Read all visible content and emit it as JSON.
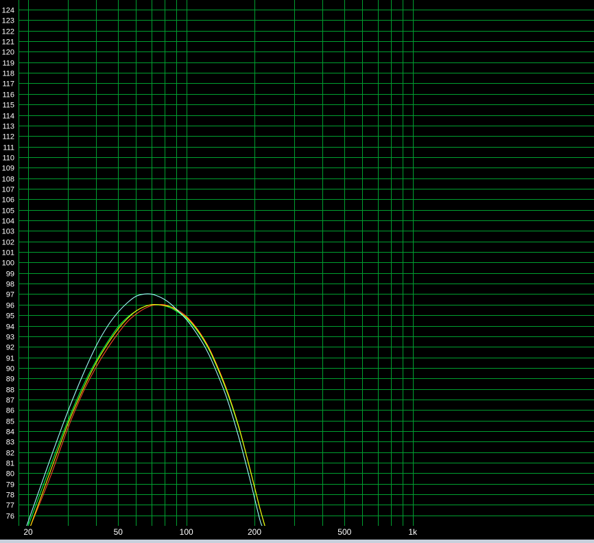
{
  "chart_data": {
    "type": "line",
    "title": "",
    "xlabel": "",
    "ylabel": "",
    "x_scale": "log",
    "xlim": [
      20,
      1000
    ],
    "ylim": [
      75,
      124.6
    ],
    "grid": true,
    "x_tick_labels": [
      {
        "value": 20,
        "label": "20"
      },
      {
        "value": 50,
        "label": "50"
      },
      {
        "value": 100,
        "label": "100"
      },
      {
        "value": 200,
        "label": "200"
      },
      {
        "value": 500,
        "label": "500"
      },
      {
        "value": 1000,
        "label": "1k"
      }
    ],
    "x_gridlines": [
      20,
      30,
      40,
      50,
      60,
      70,
      80,
      90,
      100,
      200,
      300,
      400,
      500,
      600,
      700,
      800,
      900,
      1000
    ],
    "y_tick_labels": [
      76,
      77,
      78,
      79,
      80,
      81,
      82,
      83,
      84,
      85,
      86,
      87,
      88,
      89,
      90,
      91,
      92,
      93,
      94,
      95,
      96,
      97,
      98,
      99,
      100,
      101,
      102,
      103,
      104,
      105,
      106,
      107,
      108,
      109,
      110,
      111,
      112,
      113,
      114,
      115,
      116,
      117,
      118,
      119,
      120,
      121,
      122,
      123,
      124
    ],
    "series": [
      {
        "color": "#ff4a2a",
        "x": [
          20.5,
          25,
          30,
          35,
          40,
          45,
          50,
          55,
          60,
          65,
          70,
          75,
          80,
          85,
          90,
          100,
          110,
          120,
          130,
          150,
          170,
          190,
          210,
          222
        ],
        "y": [
          75,
          79.6,
          84.3,
          87.7,
          90.1,
          91.9,
          93.3,
          94.4,
          95.1,
          95.6,
          95.9,
          96.0,
          96.0,
          95.8,
          95.6,
          94.9,
          93.9,
          92.7,
          91.3,
          88.1,
          84.5,
          80.6,
          76.9,
          75
        ]
      },
      {
        "color": "#00ff44",
        "x": [
          20,
          25,
          30,
          35,
          40,
          45,
          50,
          55,
          60,
          65,
          70,
          75,
          80,
          85,
          90,
          100,
          110,
          120,
          130,
          150,
          170,
          190,
          210,
          222
        ],
        "y": [
          75,
          80.6,
          85.0,
          88.3,
          90.7,
          92.5,
          93.9,
          94.8,
          95.4,
          95.8,
          96.0,
          96.0,
          95.9,
          95.7,
          95.4,
          94.7,
          93.7,
          92.5,
          91.1,
          87.9,
          84.4,
          80.6,
          76.9,
          75
        ]
      },
      {
        "color": "#ffee00",
        "x": [
          20.5,
          25,
          30,
          35,
          40,
          45,
          50,
          55,
          60,
          65,
          70,
          75,
          80,
          85,
          90,
          100,
          110,
          120,
          130,
          150,
          170,
          190,
          210,
          222.5
        ],
        "y": [
          75,
          80.1,
          84.7,
          88.0,
          90.5,
          92.3,
          93.7,
          94.7,
          95.4,
          95.8,
          96.0,
          96.0,
          95.9,
          95.8,
          95.5,
          94.8,
          93.8,
          92.6,
          91.2,
          88.0,
          84.5,
          80.6,
          76.9,
          75
        ]
      },
      {
        "color": "#a0ffff",
        "x": [
          19.7,
          25,
          30,
          35,
          40,
          45,
          50,
          55,
          60,
          65,
          70,
          75,
          80,
          85,
          90,
          100,
          110,
          120,
          130,
          150,
          170,
          190,
          210,
          216
        ],
        "y": [
          75,
          81.3,
          85.9,
          89.4,
          92.1,
          94.0,
          95.3,
          96.2,
          96.8,
          97.0,
          97.0,
          96.8,
          96.5,
          96.1,
          95.6,
          94.6,
          93.4,
          92.1,
          90.6,
          87.3,
          83.5,
          79.6,
          75.8,
          75
        ]
      }
    ]
  },
  "style": {
    "background": "#000000",
    "grid_color": "#00a030",
    "tick_text_color": "#ffffff",
    "bottom_bar_color": "#c8d0dc"
  }
}
